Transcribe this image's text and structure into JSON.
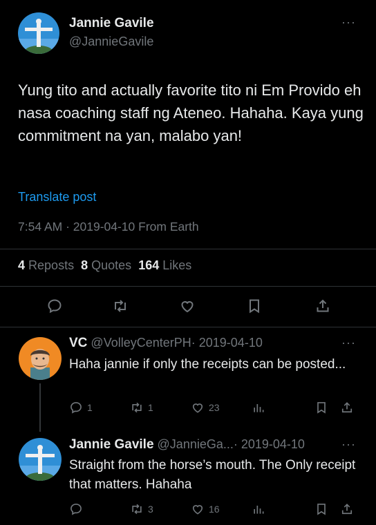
{
  "main_post": {
    "author_name": "Jannie Gavile",
    "author_handle": "@JannieGavile",
    "more": "···",
    "text": "Yung tito and actually favorite tito ni Em Provido eh nasa coaching staff ng Ateneo. Hahaha. Kaya yung commitment na yan, malabo yan!",
    "translate_label": "Translate post",
    "meta": "7:54 AM · 2019-04-10 From Earth",
    "stats": {
      "reposts_count": "4",
      "reposts_label": "Reposts",
      "quotes_count": "8",
      "quotes_label": "Quotes",
      "likes_count": "164",
      "likes_label": "Likes"
    }
  },
  "replies": [
    {
      "author_name": "VC",
      "author_handle": "@VolleyCenterPH",
      "date": "· 2019-04-10",
      "more": "···",
      "text": "Haha jannie if only the receipts can be posted...",
      "reply_count": "1",
      "repost_count": "1",
      "like_count": "23"
    },
    {
      "author_name": "Jannie Gavile",
      "author_handle": "@JannieGa...",
      "date": "· 2019-04-10",
      "more": "···",
      "text": "Straight from the horse’s mouth. The Only receipt that matters. Hahaha",
      "reply_count": "",
      "repost_count": "3",
      "like_count": "16"
    }
  ],
  "colors": {
    "background": "#000000",
    "text": "#e7e9ea",
    "muted": "#71767b",
    "link": "#1d9bf0",
    "divider": "#2f3336"
  }
}
